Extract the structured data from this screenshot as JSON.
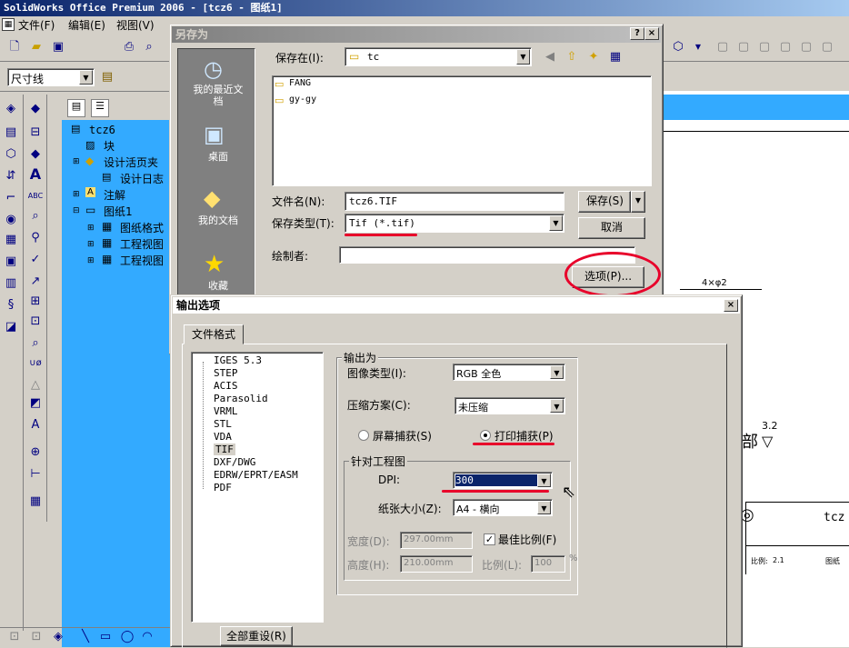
{
  "app": {
    "title": "SolidWorks Office Premium 2006 - [tcz6 - 图纸1]",
    "menu": [
      "文件(F)",
      "编辑(E)",
      "视图(V)"
    ],
    "dim_combo": "尺寸线"
  },
  "tree": {
    "root": "tcz6",
    "items": [
      "块",
      "设计活页夹",
      "设计日志",
      "注解",
      "图纸1",
      "图纸格式",
      "工程视图",
      "工程视图"
    ]
  },
  "drawing": {
    "dim_text": "4×φ2",
    "roughness": "3.2",
    "title_text": "tcz",
    "cell1": "比例:",
    "cell1b": "2.1",
    "cell2": "图纸",
    "ref_mark": "部"
  },
  "save_dialog": {
    "title": "另存为",
    "save_in_label": "保存在(I):",
    "save_in_value": "tc",
    "places": [
      "我的最近文档",
      "桌面",
      "我的文档",
      "收藏"
    ],
    "folders": [
      "FANG",
      "gy-gy"
    ],
    "filename_label": "文件名(N):",
    "filename_value": "tcz6.TIF",
    "filetype_label": "保存类型(T):",
    "filetype_value": "Tif (*.tif)",
    "author_label": "绘制者:",
    "author_value": "",
    "save_btn": "保存(S)",
    "cancel_btn": "取消",
    "options_btn": "选项(P)...",
    "help": "?",
    "close": "×"
  },
  "export_dialog": {
    "title": "输出选项",
    "tab": "文件格式",
    "close": "×",
    "formats": [
      "IGES 5.3",
      "STEP",
      "ACIS",
      "Parasolid",
      "VRML",
      "STL",
      "VDA",
      "TIF",
      "DXF/DWG",
      "EDRW/EPRT/EASM",
      "PDF"
    ],
    "selected_format": "TIF",
    "output_group": "输出为",
    "image_type_label": "图像类型(I):",
    "image_type_value": "RGB 全色",
    "compression_label": "压缩方案(C):",
    "compression_value": "未压缩",
    "screen_capture": "屏幕捕获(S)",
    "print_capture": "打印捕获(P)",
    "drawing_group": "针对工程图",
    "dpi_label": "DPI:",
    "dpi_value": "300",
    "paper_label": "纸张大小(Z):",
    "paper_value": "A4 - 横向",
    "width_label": "宽度(D):",
    "width_value": "297.00mm",
    "height_label": "高度(H):",
    "height_value": "210.00mm",
    "best_scale": "最佳比例(F)",
    "scale_label": "比例(L):",
    "scale_value": "100",
    "percent": "%",
    "reset_btn": "全部重设(R)"
  },
  "colors": {
    "accent": "#0a246a",
    "annotation": "#e8002a",
    "tree_bg": "#33aaff"
  }
}
